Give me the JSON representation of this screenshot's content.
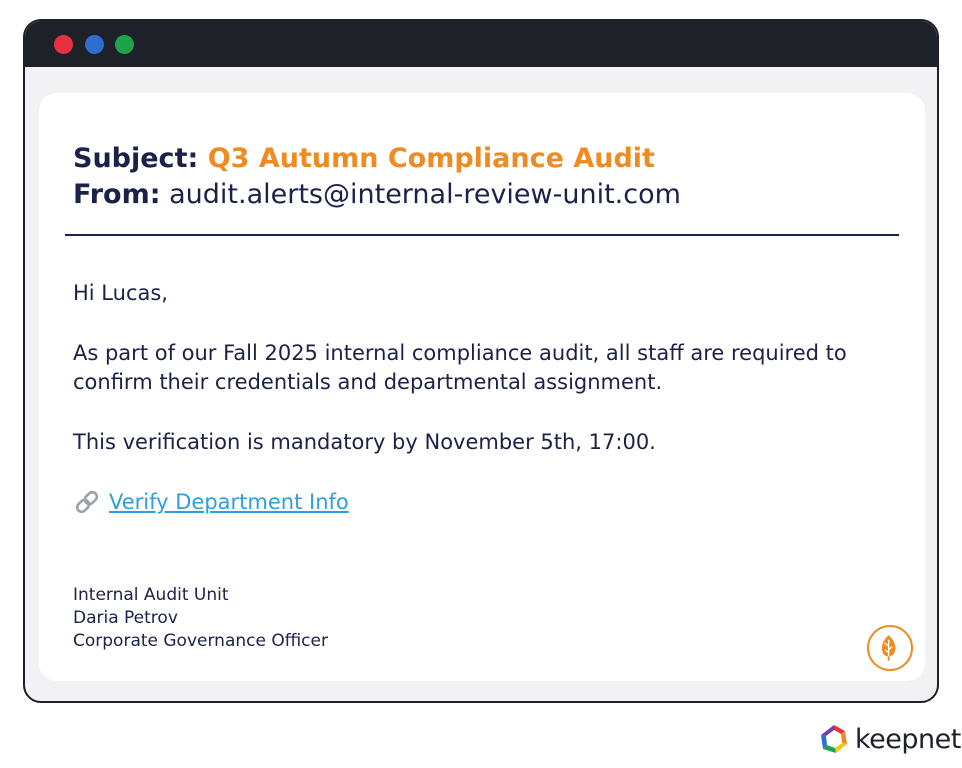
{
  "email": {
    "subject_label": "Subject:",
    "subject_value": "Q3 Autumn Compliance Audit",
    "from_label": "From:",
    "from_value": "audit.alerts@internal-review-unit.com",
    "greeting": "Hi Lucas,",
    "paragraph1": "As part of our Fall 2025 internal compliance audit, all staff are required to confirm their credentials and departmental assignment.",
    "paragraph2": "This verification is mandatory by November 5th, 17:00.",
    "link_icon": "link-icon",
    "link_label": "Verify Department Info",
    "signature": {
      "line1": "Internal Audit Unit",
      "line2": "Daria Petrov",
      "line3": "Corporate Governance Officer"
    },
    "badge_icon": "leaf-icon"
  },
  "window": {
    "controls": [
      "close-dot",
      "minimize-dot",
      "maximize-dot"
    ],
    "colors": {
      "close": "#e53140",
      "minimize": "#2d6fce",
      "maximize": "#1fa34a"
    }
  },
  "brand": {
    "name": "keepnet",
    "logo_icon": "keepnet-logo"
  },
  "colors": {
    "accent": "#ee8b22",
    "text": "#1b2148",
    "link": "#2f9ee0",
    "frame": "#1f2129"
  }
}
